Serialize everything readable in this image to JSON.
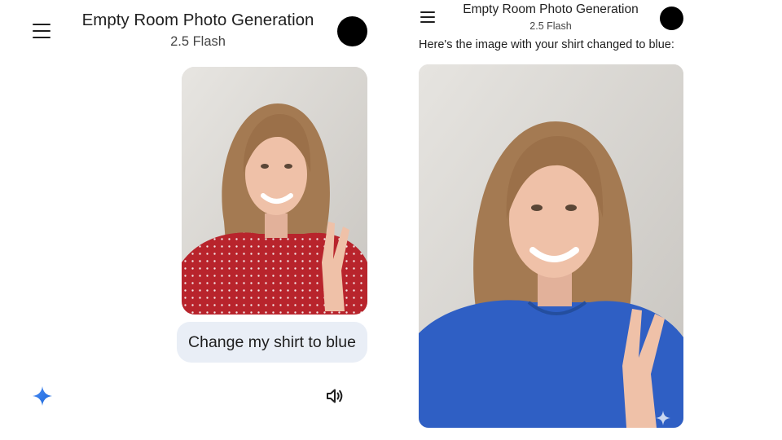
{
  "left": {
    "title": "Empty Room Photo Generation",
    "model": "2.5 Flash",
    "menu_icon": "hamburger-menu-icon",
    "avatar": "account-avatar",
    "prompt": "Change my shirt to blue",
    "gemini_icon": "gemini-sparkle-icon",
    "speaker_icon": "volume-icon"
  },
  "right": {
    "title": "Empty Room Photo Generation",
    "model": "2.5 Flash",
    "response": "Here's the image with your shirt changed to blue:"
  },
  "colors": {
    "bubble": "#e9eef6",
    "red_shirt": "#b8242c",
    "blue_shirt": "#2f5fc4",
    "gemini_blue": "#4285f4"
  }
}
